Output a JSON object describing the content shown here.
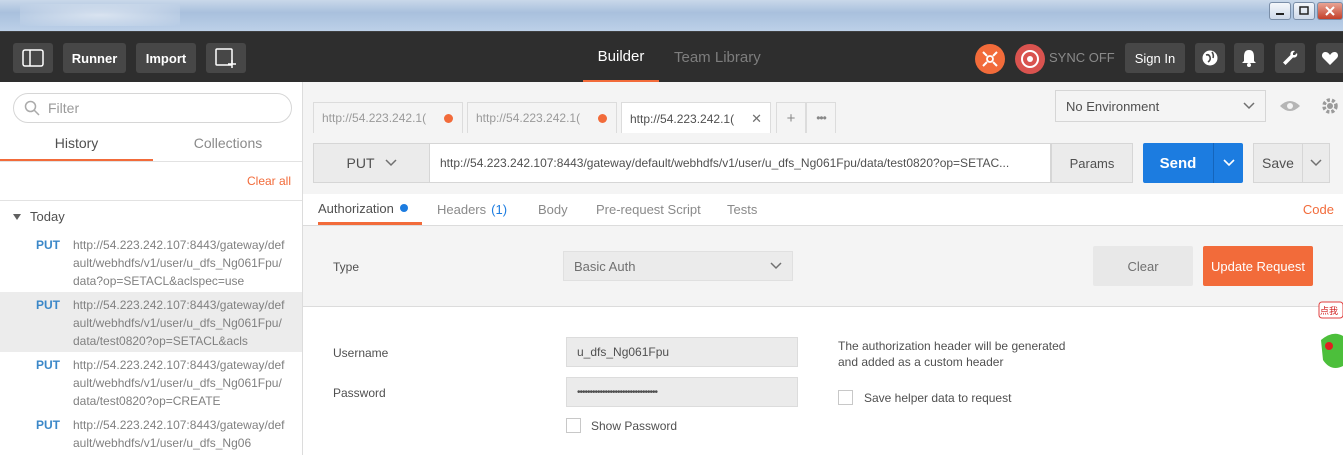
{
  "header": {
    "runner_label": "Runner",
    "import_label": "Import",
    "builder_label": "Builder",
    "team_library_label": "Team Library",
    "sync_label": "SYNC OFF",
    "sign_in_label": "Sign In",
    "accent_color": "#f26b3a"
  },
  "sidebar": {
    "filter_placeholder": "Filter",
    "tabs": [
      {
        "label": "History"
      },
      {
        "label": "Collections"
      }
    ],
    "clear_all_label": "Clear all",
    "group_label": "Today",
    "history": [
      {
        "method": "PUT",
        "url": "http://54.223.242.107:8443/gateway/default/webhdfs/v1/user/u_dfs_Ng061Fpu/data?op=SETACL&aclspec=use"
      },
      {
        "method": "PUT",
        "url": "http://54.223.242.107:8443/gateway/default/webhdfs/v1/user/u_dfs_Ng061Fpu/data/test0820?op=SETACL&acls"
      },
      {
        "method": "PUT",
        "url": "http://54.223.242.107:8443/gateway/default/webhdfs/v1/user/u_dfs_Ng061Fpu/data/test0820?op=CREATE"
      },
      {
        "method": "PUT",
        "url": "http://54.223.242.107:8443/gateway/default/webhdfs/v1/user/u_dfs_Ng06"
      }
    ]
  },
  "request_tabs": [
    {
      "label": "http://54.223.242.1("
    },
    {
      "label": "http://54.223.242.1("
    },
    {
      "label": "http://54.223.242.1("
    }
  ],
  "environment": {
    "selected": "No Environment"
  },
  "request": {
    "method": "PUT",
    "url": "http://54.223.242.107:8443/gateway/default/webhdfs/v1/user/u_dfs_Ng061Fpu/data/test0820?op=SETAC...",
    "params_label": "Params",
    "send_label": "Send",
    "save_label": "Save",
    "send_color": "#1c7ce0"
  },
  "subtabs": {
    "authorization": "Authorization",
    "headers": "Headers",
    "headers_count": "(1)",
    "body": "Body",
    "prerequest": "Pre-request Script",
    "tests": "Tests",
    "code": "Code"
  },
  "auth": {
    "type_label": "Type",
    "type_value": "Basic Auth",
    "clear_label": "Clear",
    "update_label": "Update Request",
    "username_label": "Username",
    "username_value": "u_dfs_Ng061Fpu",
    "password_label": "Password",
    "password_value": "••••••••••••••••••••••••••••••••",
    "show_password_label": "Show Password",
    "note": "The authorization header will be generated and added as a custom header",
    "save_helper_label": "Save helper data to request"
  },
  "overlay": {
    "mascot_text": "点我"
  }
}
